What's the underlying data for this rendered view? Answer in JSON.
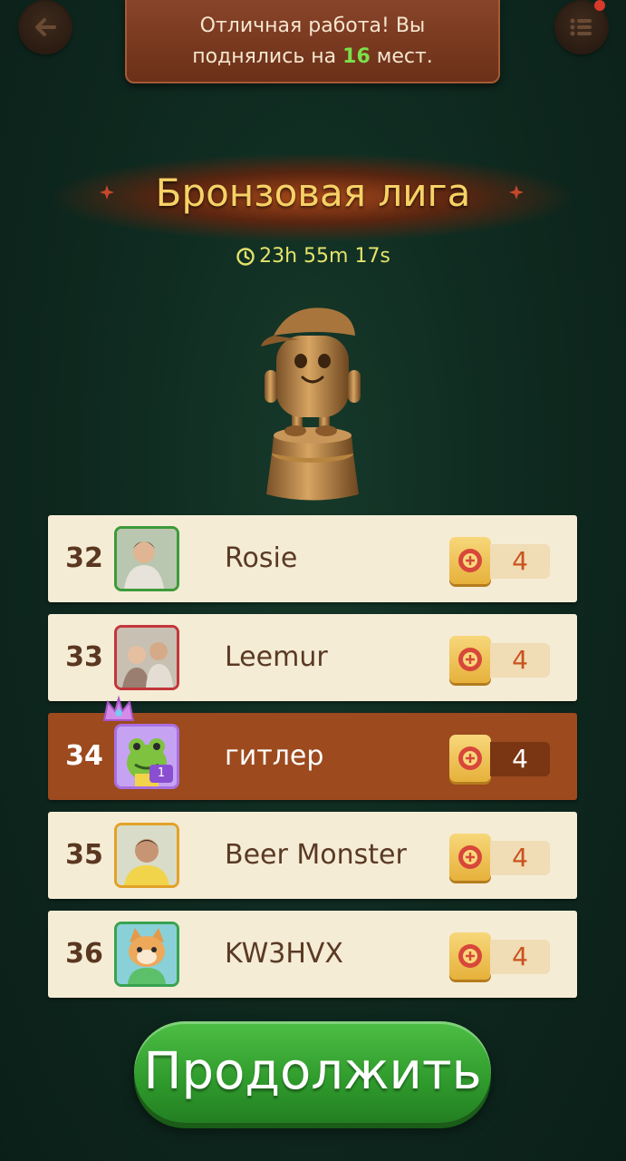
{
  "banner": {
    "line1": "Отличная работа! Вы",
    "line2_prefix": "поднялись на ",
    "line2_number": "16",
    "line2_suffix": " мест."
  },
  "league": {
    "title": "Бронзовая лига",
    "timer": "23h 55m 17s"
  },
  "leaderboard": [
    {
      "rank": "32",
      "name": "Rosie",
      "score": "4"
    },
    {
      "rank": "33",
      "name": "Leemur",
      "score": "4"
    },
    {
      "rank": "34",
      "name": "гитлер",
      "score": "4",
      "level": "1"
    },
    {
      "rank": "35",
      "name": "Beer Monster",
      "score": "4"
    },
    {
      "rank": "36",
      "name": "KW3HVX",
      "score": "4"
    }
  ],
  "continue_label": "Продолжить",
  "icons": {
    "back": "arrow-left-icon",
    "menu": "list-menu-icon",
    "timer": "clock-icon",
    "score": "mahjong-tile-icon"
  },
  "colors": {
    "accent_green": "#3d9a3a",
    "highlight_row": "#9c4a1e",
    "league_gold": "#f6d266"
  }
}
